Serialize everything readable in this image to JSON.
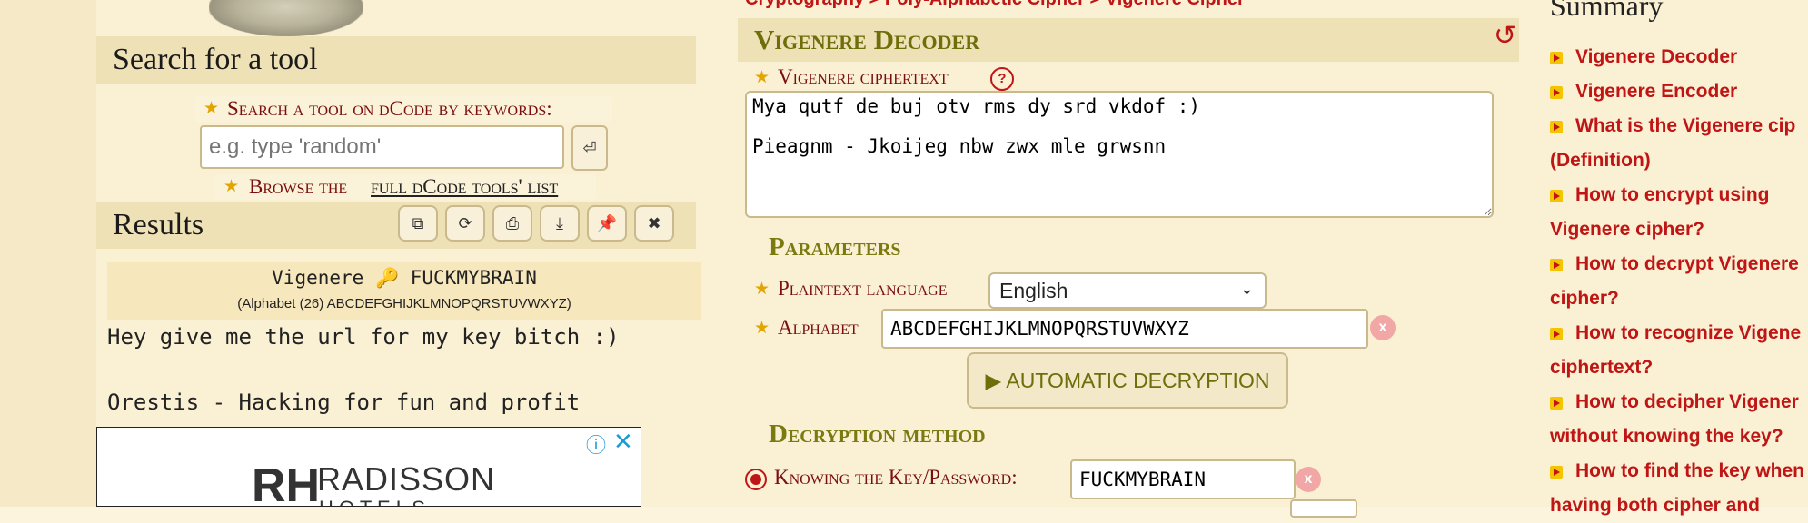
{
  "left": {
    "search_heading": "Search for a tool",
    "search_label": "Search a tool on dCode by keywords:",
    "search_placeholder": "e.g. type 'random'",
    "browse_prefix": "Browse the",
    "browse_link": "full dCode tools' list",
    "results_heading": "Results",
    "result_title": "Vigenere",
    "result_key": "FUCKMYBRAIN",
    "result_alphabet": "(Alphabet (26) ABCDEFGHIJKLMNOPQRSTUVWXYZ)",
    "output_line1": "Hey give me the url for my key bitch :)",
    "output_line2": "Orestis - Hacking for fun and profit",
    "ad_brand": "RADISSON",
    "ad_sub": "H O T E L S",
    "ad_logo": "RH"
  },
  "middle": {
    "breadcrumb": "Cryptography > Poly-Alphabetic Cipher > Vigenere Cipher",
    "panel_title": "Vigenere Decoder",
    "ciphertext_label": "Vigenere ciphertext",
    "ciphertext_value": "Mya qutf de buj otv rms dy srd vkdof :)\n\nPieagnm - Jkoijeg nbw zwx mle grwsnn",
    "parameters_heading": "Parameters",
    "plaintext_language_label": "Plaintext language",
    "plaintext_language_value": "English",
    "alphabet_label": "Alphabet",
    "alphabet_value": "ABCDEFGHIJKLMNOPQRSTUVWXYZ",
    "auto_decrypt_label": "▶ AUTOMATIC DECRYPTION",
    "decryption_method_heading": "Decryption method",
    "knowing_key_label": "Knowing the Key/Password:",
    "key_value": "FUCKMYBRAIN"
  },
  "summary": {
    "heading": "Summary",
    "items": [
      "Vigenere Decoder",
      "Vigenere Encoder",
      "What is the Vigenere cip",
      "(Definition)",
      "How to encrypt using",
      "Vigenere cipher?",
      "How to decrypt Vigenere",
      "cipher?",
      "How to recognize Vigene",
      "ciphertext?",
      "How to decipher Vigener",
      "without knowing the key?",
      "How to find the key when",
      "having both cipher and"
    ]
  },
  "colors": {
    "accent_red": "#c01515",
    "heading_olive": "#7a7a10",
    "bar_bg": "#efe1b6"
  }
}
